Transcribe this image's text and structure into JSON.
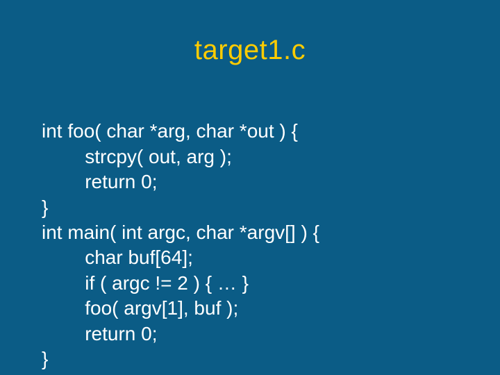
{
  "title": "target1.c",
  "code": {
    "l1": "int foo( char *arg, char *out ) {",
    "l2": "        strcpy( out, arg );",
    "l3": "        return 0;",
    "l4": "}",
    "l5": "int main( int argc, char *argv[] ) {",
    "l6": "        char buf[64];",
    "l7": "        if ( argc != 2 ) { … }",
    "l8": "        foo( argv[1], buf );",
    "l9": "        return 0;",
    "l10": "}"
  }
}
